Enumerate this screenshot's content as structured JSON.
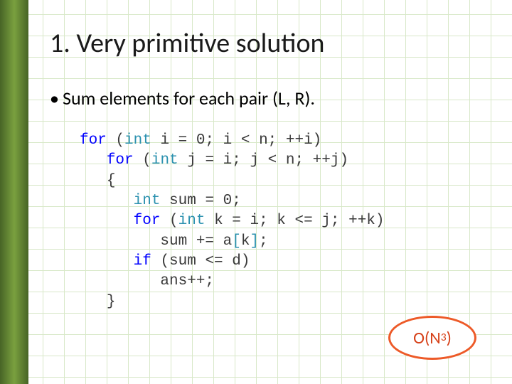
{
  "title": "1. Very primitive solution",
  "bullet": "Sum elements for each pair (L, R).",
  "code": {
    "l1_for": "for",
    "l1_int": "int",
    "l1_rest": " i = 0; i < n; ++i)",
    "l2_for": "for",
    "l2_int": "int",
    "l2_rest": " j = i; j < n; ++j)",
    "l3": "{",
    "l4_int": "int",
    "l4_rest": " sum = 0;",
    "l5_for": "for",
    "l5_int": "int",
    "l5_rest": " k = i; k <= j; ++k)",
    "l6_pre": "sum += a",
    "l6_lb": "[",
    "l6_idx": "k",
    "l6_rb": "]",
    "l6_post": ";",
    "l7_if": "if",
    "l7_rest": " (sum <= d)",
    "l8": "ans++;",
    "l9": "}"
  },
  "complexity": {
    "base": "O(N",
    "exp": "3",
    "close": ")"
  }
}
